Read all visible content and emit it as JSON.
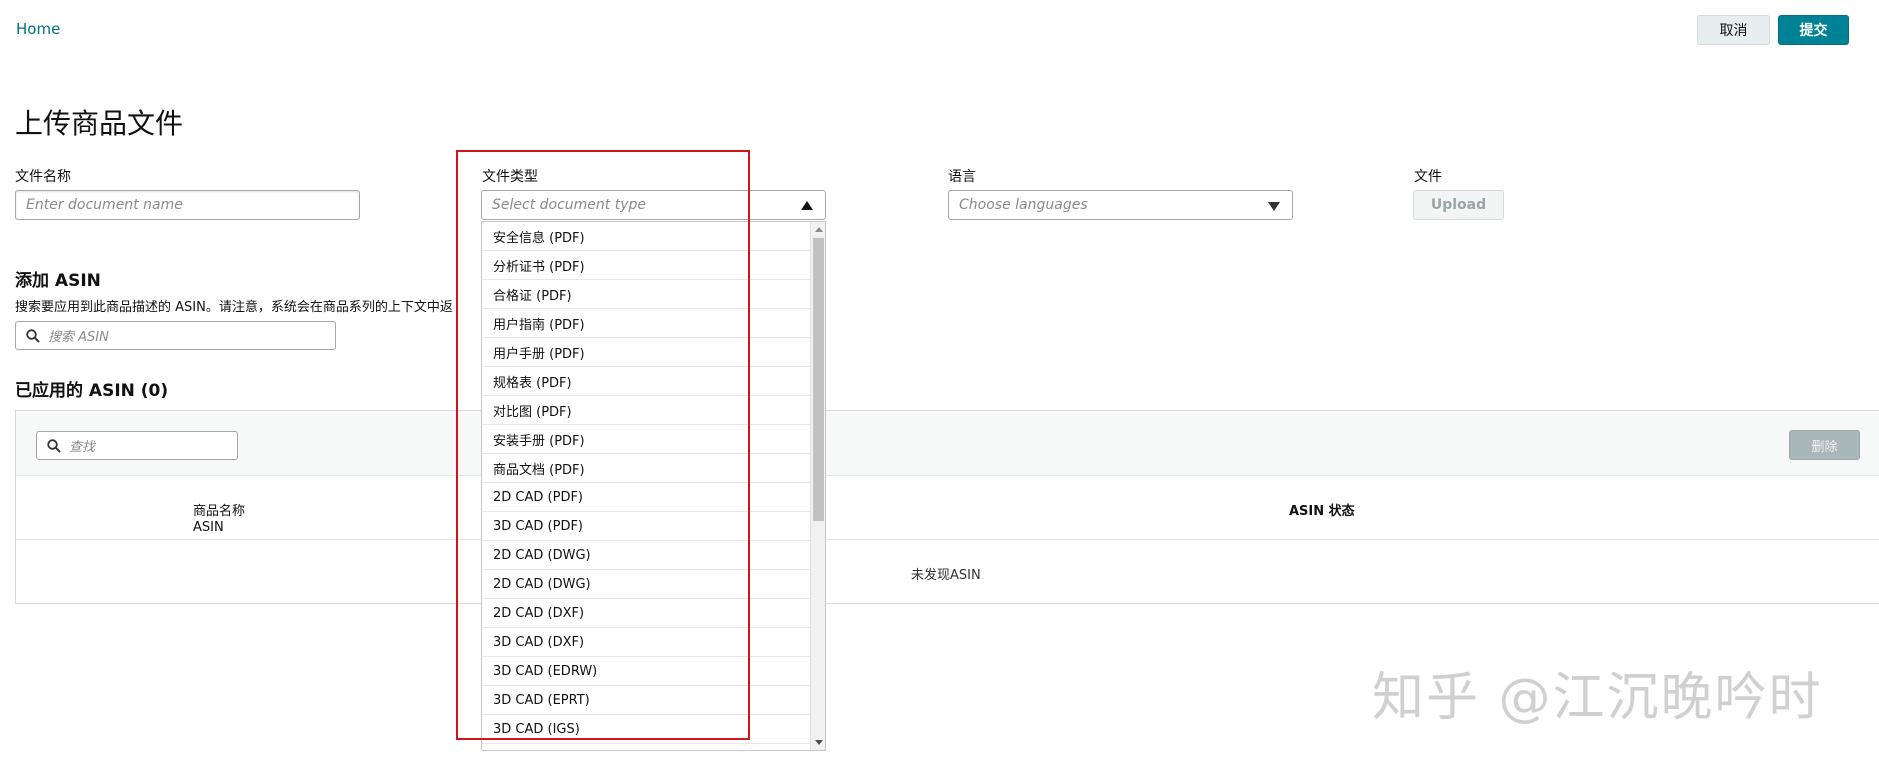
{
  "header": {
    "breadcrumb_home": "Home",
    "cancel_label": "取消",
    "submit_label": "提交"
  },
  "page_title": "上传商品文件",
  "form": {
    "doc_name": {
      "label": "文件名称",
      "placeholder": "Enter document name"
    },
    "doc_type": {
      "label": "文件类型",
      "placeholder": "Select document type"
    },
    "language": {
      "label": "语言",
      "placeholder": "Choose languages"
    },
    "file": {
      "label": "文件",
      "upload_label": "Upload"
    }
  },
  "doc_type_options": [
    "安全信息 (PDF)",
    "分析证书 (PDF)",
    "合格证 (PDF)",
    "用户指南 (PDF)",
    "用户手册 (PDF)",
    "规格表 (PDF)",
    "对比图 (PDF)",
    "安装手册 (PDF)",
    "商品文档 (PDF)",
    "2D CAD (PDF)",
    "3D CAD (PDF)",
    "2D CAD (DWG)",
    "2D CAD (DWG)",
    "2D CAD (DXF)",
    "3D CAD (DXF)",
    "3D CAD (EDRW)",
    "3D CAD (EPRT)",
    "3D CAD (IGS)"
  ],
  "add_asin": {
    "title": "添加 ASIN",
    "help_text": "搜索要应用到此商品描述的 ASIN。请注意，系统会在商品系列的上下文中返",
    "search_placeholder": "搜索 ASIN"
  },
  "applied_asin": {
    "title": "已应用的 ASIN (0)",
    "filter_placeholder": "查找",
    "delete_label": "删除",
    "columns": {
      "product_name": "商品名称",
      "asin": "ASIN",
      "asin_status": "ASIN 状态"
    },
    "empty_text": "未发现ASIN"
  },
  "watermark": "知乎 @江沉晚吟时",
  "colors": {
    "link": "#007185",
    "primary_button": "#008296",
    "highlight": "#d0141b"
  }
}
